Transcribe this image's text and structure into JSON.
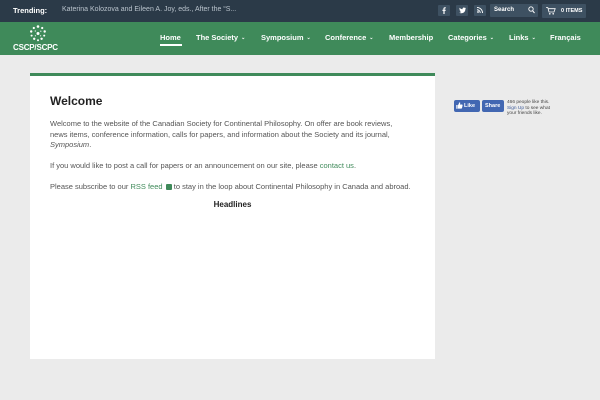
{
  "topbar": {
    "trending_label": "Trending:",
    "trending_text": "Katerina Kolozova and Eileen A. Joy, eds., After the “S...",
    "social_icons": [
      "facebook-icon",
      "twitter-icon",
      "rss-icon"
    ],
    "search_label": "Search",
    "cart_label": "0 ITEMS"
  },
  "nav": {
    "logo_text": "CSCP/SCPC",
    "items": [
      {
        "label": "Home",
        "dropdown": false,
        "active": true
      },
      {
        "label": "The Society",
        "dropdown": true
      },
      {
        "label": "Symposium",
        "dropdown": true
      },
      {
        "label": "Conference",
        "dropdown": true
      },
      {
        "label": "Membership",
        "dropdown": false
      },
      {
        "label": "Categories",
        "dropdown": true
      },
      {
        "label": "Links",
        "dropdown": true
      },
      {
        "label": "Français",
        "dropdown": false
      }
    ],
    "chevron": "⌄"
  },
  "main": {
    "title": "Welcome",
    "intro_line1": "Welcome to the website of the Canadian Society for Continental Philosophy. On offer are book reviews,",
    "intro_line2": "news items, conference information, calls for papers, and information about the Society and its journal,",
    "intro_journal": "Symposium",
    "intro_end": ".",
    "call_text": "If you would like to post a call for papers or an announcement on our site, please ",
    "call_link": "contact us",
    "call_end": ".",
    "rss_pre": "Please subscribe to our ",
    "rss_link": "RSS feed",
    "rss_post": " to stay in the loop about Continental Philosophy in Canada and abroad.",
    "headlines": "Headlines"
  },
  "facebook": {
    "like_label": "Like",
    "share_label": "Share",
    "count_text": "466 people like this.",
    "signup_link": "Sign Up",
    "signup_text": " to see what your friends like."
  },
  "colors": {
    "accent": "#3f8a5a",
    "topbar": "#2b3a48",
    "facebook": "#4267b2"
  }
}
